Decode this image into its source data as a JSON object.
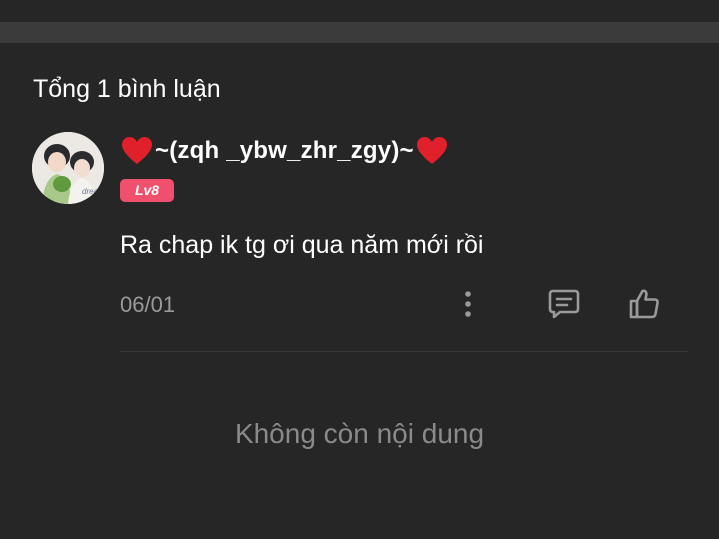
{
  "comments_section": {
    "total_label": "Tổng 1 bình luận",
    "end_message": "Không còn nội dung"
  },
  "comment": {
    "username": "~(zqh _ybw_zhr_zgy)~",
    "level": "Lv8",
    "text": "Ra chap ik tg ơi qua năm mới rồi",
    "date": "06/01",
    "avatar_caption": "drea"
  },
  "icons": {
    "username_decoration": "heart-icon",
    "more": "more-vertical-icon",
    "reply": "comment-icon",
    "like": "thumbs-up-icon"
  },
  "colors": {
    "background": "#262626",
    "heart": "#e0202a",
    "level_badge": "#f0506e",
    "muted_text": "#9a9a9a"
  }
}
